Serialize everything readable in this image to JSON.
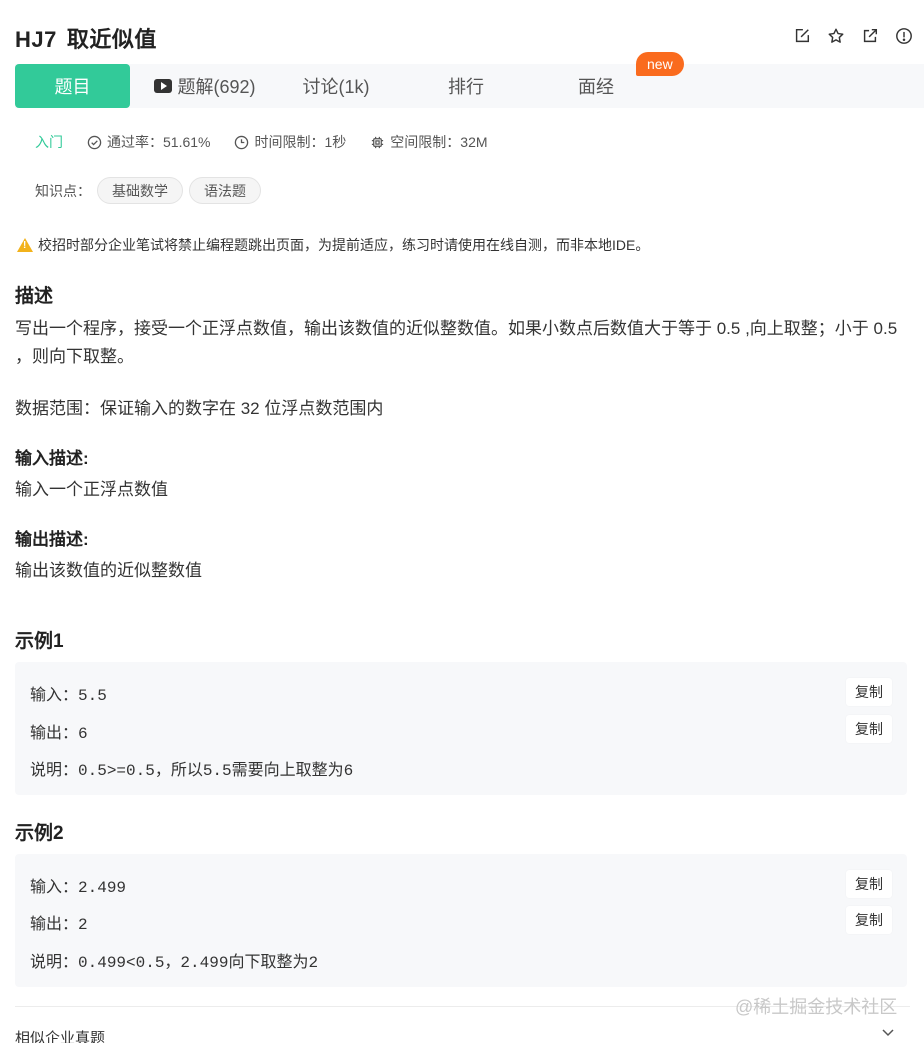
{
  "problem": {
    "code": "HJ7",
    "name": "取近似值"
  },
  "header_icons": [
    "edit-icon",
    "star-icon",
    "external-link-icon",
    "info-icon"
  ],
  "tabs": [
    {
      "label": "题目",
      "active": true
    },
    {
      "label": "题解(692)",
      "icon": "video-icon"
    },
    {
      "label": "讨论(1k)"
    },
    {
      "label": "排行"
    },
    {
      "label": "面经",
      "badge": "new"
    }
  ],
  "meta": {
    "level": "入门",
    "pass_rate": "通过率：51.61%",
    "time_limit": "时间限制：1秒",
    "space_limit": "空间限制：32M"
  },
  "knowledge": {
    "label": "知识点：",
    "tags": [
      "基础数学",
      "语法题"
    ]
  },
  "notice": "校招时部分企业笔试将禁止编程题跳出页面，为提前适应，练习时请使用在线自测，而非本地IDE。",
  "description": {
    "title": "描述",
    "text": "写出一个程序，接受一个正浮点数值，输出该数值的近似整数值。如果小数点后数值大于等于 0.5 ,向上取整；小于 0.5 ，则向下取整。",
    "range": "数据范围：保证输入的数字在 32 位浮点数范围内"
  },
  "input_desc": {
    "title": "输入描述:",
    "text": "输入一个正浮点数值"
  },
  "output_desc": {
    "title": "输出描述:",
    "text": "输出该数值的近似整数值"
  },
  "examples": [
    {
      "title": "示例1",
      "input_label": "输入：",
      "input": "5.5",
      "output_label": "输出：",
      "output": "6",
      "note_label": "说明：",
      "note": "0.5>=0.5，所以5.5需要向上取整为6",
      "copy_label": "复制"
    },
    {
      "title": "示例2",
      "input_label": "输入：",
      "input": "2.499",
      "output_label": "输出：",
      "output": "2",
      "note_label": "说明：",
      "note": "0.499<0.5，2.499向下取整为2",
      "copy_label": "复制"
    }
  ],
  "similar": "相似企业真题",
  "watermark": "@稀土掘金技术社区",
  "colors": {
    "accent": "#32ca99",
    "badge": "#fa6b1e",
    "warning": "#f2b21b"
  }
}
